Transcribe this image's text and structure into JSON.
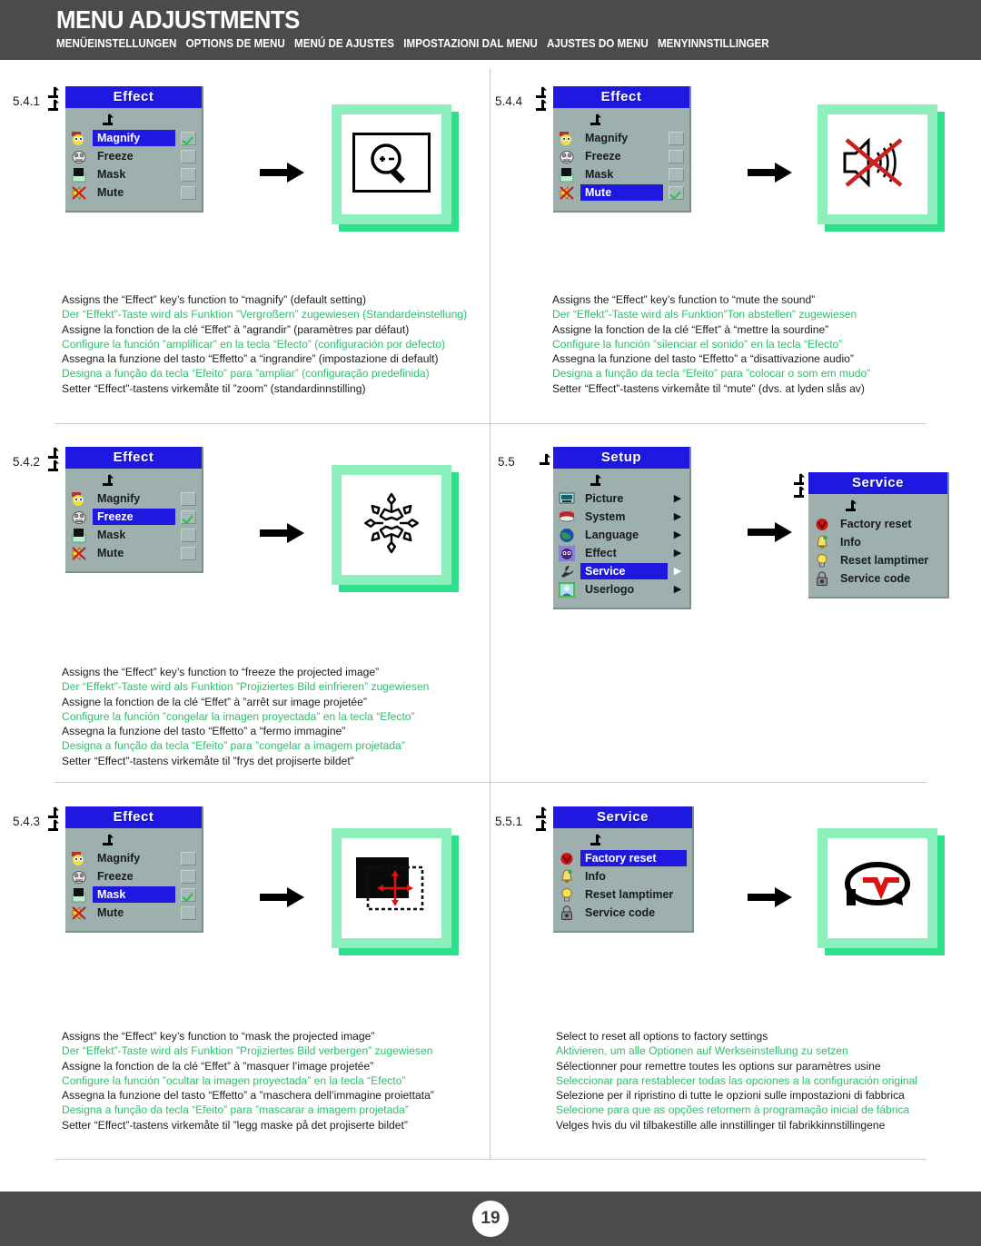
{
  "header": {
    "title": "MENU ADJUSTMENTS",
    "subtitles": [
      "MENÜEINSTELLUNGEN",
      "OPTIONS DE MENU",
      "MENÚ DE AJUSTES",
      "IMPOSTAZIONI DAL MENU",
      "AJUSTES DO MENU",
      "MENYINNSTILLINGER"
    ]
  },
  "footer": {
    "page_number": "19"
  },
  "colors": {
    "header_bg": "#4b4b4b",
    "osd_panel": "#9db0ad",
    "osd_title_bg": "#1f18e0",
    "highlight": "#1f18e0",
    "card_green_light": "#8cf0bd",
    "card_green_dark": "#2fe08b",
    "alt_text": "#2bbf6b",
    "check_green": "#23c24a",
    "divider": "#c9c9c9"
  },
  "sections": [
    {
      "id": "5.4.1",
      "number": "5.4.1",
      "menu": {
        "title": "Effect",
        "rows": [
          {
            "label": "Magnify",
            "icon": "magnify-icon",
            "selected": true,
            "checked": true
          },
          {
            "label": "Freeze",
            "icon": "freeze-icon",
            "selected": false,
            "checked": false
          },
          {
            "label": "Mask",
            "icon": "mask-icon",
            "selected": false,
            "checked": false
          },
          {
            "label": "Mute",
            "icon": "mute-icon",
            "selected": false,
            "checked": false
          }
        ]
      },
      "result_icon": "magnify-screen-icon",
      "description": [
        {
          "text": "Assigns the “Effect” key’s function to “magnify” (default setting)",
          "alt": false
        },
        {
          "text": "Der “Effekt”-Taste wird als Funktion ”Vergroßern” zugewiesen (Standardeinstellung)",
          "alt": true
        },
        {
          "text": "Assigne la fonction de la clé “Effet” à ”agrandir” (paramètres par défaut)",
          "alt": false
        },
        {
          "text": "Configure la función ”amplificar” en la tecla “Efecto” (configuración por defecto)",
          "alt": true
        },
        {
          "text": "Assegna la funzione del tasto “Effetto” a “ingrandire” (impostazione di default)",
          "alt": false
        },
        {
          "text": "Designa a função da tecla “Efeito” para ”ampliar” (configuração predefinida)",
          "alt": true
        },
        {
          "text": "Setter “Effect”-tastens virkemåte til ”zoom” (standardinnstilling)",
          "alt": false
        }
      ]
    },
    {
      "id": "5.4.4",
      "number": "5.4.4",
      "menu": {
        "title": "Effect",
        "rows": [
          {
            "label": "Magnify",
            "icon": "magnify-icon",
            "selected": false,
            "checked": false
          },
          {
            "label": "Freeze",
            "icon": "freeze-icon",
            "selected": false,
            "checked": false
          },
          {
            "label": "Mask",
            "icon": "mask-icon",
            "selected": false,
            "checked": false
          },
          {
            "label": "Mute",
            "icon": "mute-icon",
            "selected": true,
            "checked": true
          }
        ]
      },
      "result_icon": "mute-speaker-icon",
      "description": [
        {
          "text": "Assigns the “Effect” key’s function to “mute the sound”",
          "alt": false
        },
        {
          "text": "Der “Effekt”-Taste wird als Funktion”Ton abstellen” zugewiesen",
          "alt": true
        },
        {
          "text": "Assigne la fonction de la clé “Effet” à “mettre la sourdine”",
          "alt": false
        },
        {
          "text": "Configure la función ”silenciar el sonido” en la tecla “Efecto”",
          "alt": true
        },
        {
          "text": "Assegna la funzione del tasto “Effetto” a “disattivazione audio”",
          "alt": false
        },
        {
          "text": "Designa a função da tecla “Efeito” para ”colocar o som em mudo”",
          "alt": true
        },
        {
          "text": "Setter “Effect”-tastens virkemåte til “mute” (dvs. at lyden slås av)",
          "alt": false
        }
      ]
    },
    {
      "id": "5.4.2",
      "number": "5.4.2",
      "menu": {
        "title": "Effect",
        "rows": [
          {
            "label": "Magnify",
            "icon": "magnify-icon",
            "selected": false,
            "checked": false
          },
          {
            "label": "Freeze",
            "icon": "freeze-icon",
            "selected": true,
            "checked": true
          },
          {
            "label": "Mask",
            "icon": "mask-icon",
            "selected": false,
            "checked": false
          },
          {
            "label": "Mute",
            "icon": "mute-icon",
            "selected": false,
            "checked": false
          }
        ]
      },
      "result_icon": "snowflake-icon",
      "description": [
        {
          "text": "Assigns the “Effect” key’s function to “freeze the projected image”",
          "alt": false
        },
        {
          "text": "Der “Effekt”-Taste wird als Funktion ”Projiziertes Bild einfrieren” zugewiesen",
          "alt": true
        },
        {
          "text": "Assigne la fonction de la clé “Effet” à ”arrêt sur image projetée”",
          "alt": false
        },
        {
          "text": "Configure la función ”congelar la imagen proyectada” en la tecla “Efecto”",
          "alt": true
        },
        {
          "text": "Assegna la funzione del tasto “Effetto” a “fermo immagine”",
          "alt": false
        },
        {
          "text": "Designa a função da tecla “Efeito” para ”congelar a imagem projetada”",
          "alt": true
        },
        {
          "text": "Setter “Effect”-tastens virkemåte til ”frys det projiserte bildet”",
          "alt": false
        }
      ]
    },
    {
      "id": "5.5",
      "number": "5.5",
      "menu": {
        "title": "Setup",
        "rows": [
          {
            "label": "Picture",
            "icon": "picture-icon",
            "selected": false,
            "submenu": true
          },
          {
            "label": "System",
            "icon": "system-icon",
            "selected": false,
            "submenu": true
          },
          {
            "label": "Language",
            "icon": "language-icon",
            "selected": false,
            "submenu": true
          },
          {
            "label": "Effect",
            "icon": "effect-icon",
            "selected": false,
            "submenu": true
          },
          {
            "label": "Service",
            "icon": "service-icon",
            "selected": true,
            "submenu": true
          },
          {
            "label": "Userlogo",
            "icon": "userlogo-icon",
            "selected": false,
            "submenu": true
          }
        ]
      },
      "result_menu": {
        "title": "Service",
        "rows": [
          {
            "label": "Factory reset",
            "icon": "factory-reset-icon",
            "selected": false
          },
          {
            "label": "Info",
            "icon": "info-icon",
            "selected": false
          },
          {
            "label": "Reset lamptimer",
            "icon": "lamptimer-icon",
            "selected": false
          },
          {
            "label": "Service code",
            "icon": "service-code-icon",
            "selected": false
          }
        ]
      },
      "description": []
    },
    {
      "id": "5.4.3",
      "number": "5.4.3",
      "menu": {
        "title": "Effect",
        "rows": [
          {
            "label": "Magnify",
            "icon": "magnify-icon",
            "selected": false,
            "checked": false
          },
          {
            "label": "Freeze",
            "icon": "freeze-icon",
            "selected": false,
            "checked": false
          },
          {
            "label": "Mask",
            "icon": "mask-icon",
            "selected": true,
            "checked": true
          },
          {
            "label": "Mute",
            "icon": "mute-icon",
            "selected": false,
            "checked": false
          }
        ]
      },
      "result_icon": "mask-frame-icon",
      "description": [
        {
          "text": "Assigns the “Effect” key’s function to “mask the projected image”",
          "alt": false
        },
        {
          "text": "Der “Effekt”-Taste wird als Funktion ”Projiziertes Bild verbergen” zugewiesen",
          "alt": true
        },
        {
          "text": "Assigne la fonction de la clé “Effet” à ”masquer l’image projetée”",
          "alt": false
        },
        {
          "text": "Configure la función ”ocultar la imagen proyectada” en la tecla “Efecto”",
          "alt": true
        },
        {
          "text": "Assegna la funzione del tasto “Effetto” a ”maschera dell’immagine proiettata”",
          "alt": false
        },
        {
          "text": "Designa a função da tecla “Efeito” para ”mascarar a imagem projetada”",
          "alt": true
        },
        {
          "text": "Setter “Effect”-tastens virkemåte til ”legg maske på det projiserte bildet”",
          "alt": false
        }
      ]
    },
    {
      "id": "5.5.1",
      "number": "5.5.1",
      "menu": {
        "title": "Service",
        "rows": [
          {
            "label": "Factory reset",
            "icon": "factory-reset-icon",
            "selected": true
          },
          {
            "label": "Info",
            "icon": "info-icon",
            "selected": false
          },
          {
            "label": "Reset lamptimer",
            "icon": "lamptimer-icon",
            "selected": false
          },
          {
            "label": "Service code",
            "icon": "service-code-icon",
            "selected": false
          }
        ]
      },
      "result_icon": "factory-reset-loop-icon",
      "description": [
        {
          "text": "Select to reset all options to factory settings",
          "alt": false
        },
        {
          "text": "Aktivieren, um alle Optionen auf Werkseinstellung zu setzen",
          "alt": true
        },
        {
          "text": "Sélectionner pour remettre toutes les options sur paramètres usine",
          "alt": false
        },
        {
          "text": "Seleccionar para restablecer todas las opciones a la configuración original",
          "alt": true
        },
        {
          "text": "Selezione per il ripristino di tutte le opzioni sulle impostazioni di fabbrica",
          "alt": false
        },
        {
          "text": "Selecione para que as opções retornem à programação inicial de fábrica",
          "alt": true
        },
        {
          "text": "Velges hvis du vil tilbakestille alle innstillinger til fabrikkinnstillingene",
          "alt": false
        }
      ]
    }
  ]
}
